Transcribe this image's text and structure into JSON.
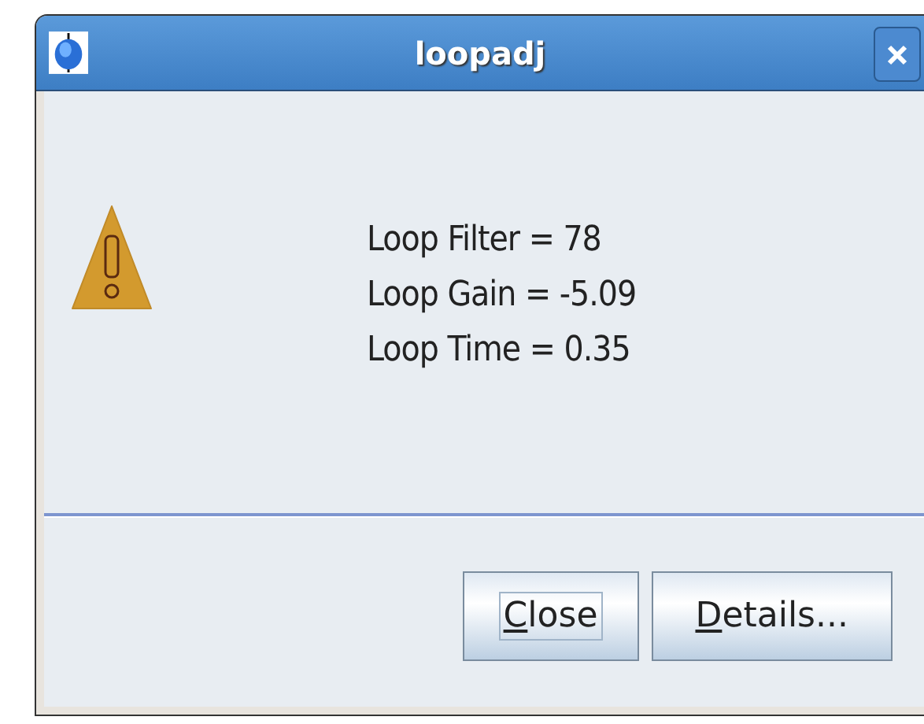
{
  "window": {
    "title": "loopadj"
  },
  "message_lines": [
    "Loop Filter = 78",
    "Loop Gain = -5.09",
    "Loop Time = 0.35"
  ],
  "buttons": [
    {
      "label": "Close",
      "focused": true
    },
    {
      "label": "Details...",
      "focused": false
    }
  ]
}
